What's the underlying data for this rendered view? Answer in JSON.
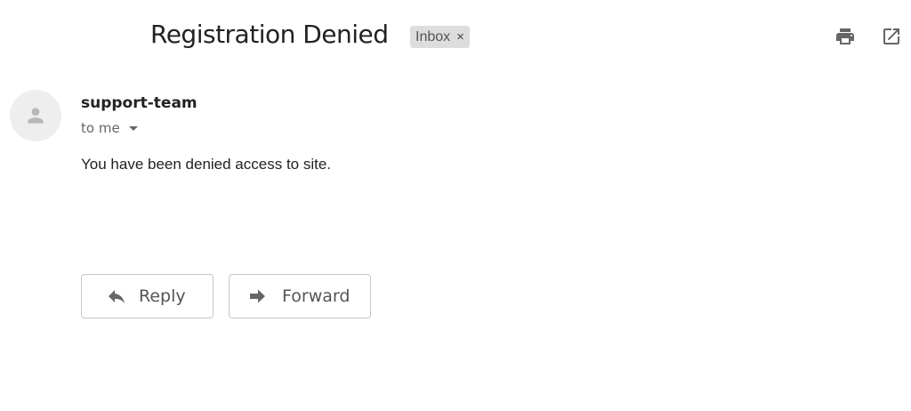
{
  "header": {
    "subject": "Registration Denied",
    "label_chip": {
      "text": "Inbox",
      "close_glyph": "×"
    },
    "icons": [
      "print-icon",
      "open-in-new-window-icon"
    ]
  },
  "message": {
    "sender_name": "support-team",
    "recipient_text": "to me",
    "body": "You have been denied access to site.",
    "avatar_icon": "person-icon"
  },
  "actions": {
    "reply_label": "Reply",
    "forward_label": "Forward",
    "reply_icon": "reply-arrow-icon",
    "forward_icon": "forward-arrow-icon"
  },
  "colors": {
    "text_primary": "#222222",
    "text_secondary": "#666666",
    "chip_background": "#dddddd",
    "icon_gray": "#666666",
    "button_border": "#c6c6c6"
  }
}
